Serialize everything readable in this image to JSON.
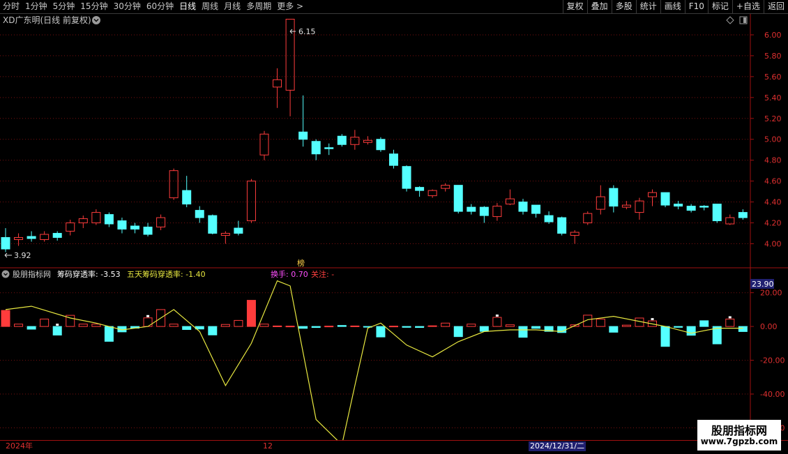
{
  "toolbar": {
    "tabs": [
      "分时",
      "1分钟",
      "5分钟",
      "15分钟",
      "30分钟",
      "60分钟",
      "日线",
      "周线",
      "月线",
      "多周期",
      "更多 >"
    ],
    "active_tab": "日线",
    "tools": [
      "复权",
      "叠加",
      "多股",
      "统计",
      "画线",
      "F10",
      "标记",
      "+自选",
      "返回"
    ]
  },
  "stock": {
    "title": "XD广东明(日线 前复权)"
  },
  "main_chart": {
    "high_label": "6.15",
    "low_label": "3.92",
    "marker_text": "榜",
    "y_ticks": [
      "6.00",
      "5.80",
      "5.60",
      "5.40",
      "5.20",
      "5.00",
      "4.80",
      "4.60",
      "4.40",
      "4.20",
      "4.00"
    ],
    "y_tick_values": [
      6.0,
      5.8,
      5.6,
      5.4,
      5.2,
      5.0,
      4.8,
      4.6,
      4.4,
      4.2,
      4.0
    ],
    "price_range": [
      3.85,
      6.2
    ]
  },
  "indicator": {
    "name": "股朋指标网",
    "series1_label": "筹码穿透率: -3.53",
    "series2_label": "五天筹码穿透率: -1.40",
    "turnover_label": "换手: 0.70",
    "focus_label": "关注: -",
    "current_value": "23.90",
    "y_ticks": [
      "20.00",
      "0.00",
      "-20.00",
      "-40.00",
      "-60.00"
    ],
    "y_tick_values": [
      20,
      0,
      -20,
      -40,
      -60
    ],
    "value_range": [
      -66,
      24
    ]
  },
  "bottom_axis": {
    "labels": [
      "2024年",
      "12"
    ],
    "cursor_date": "2024/12/31/二"
  },
  "watermark": {
    "name": "股朋指标网",
    "url": "www.7gpzb.com"
  },
  "colors": {
    "up": "#ff3c3c",
    "down": "#54ffff",
    "line": "#e8e840",
    "axis": "#a01010",
    "grid": "#7a1010"
  },
  "chart_data": {
    "type": "candlestick",
    "candles": [
      [
        4.06,
        3.95,
        4.15,
        3.92
      ],
      [
        4.04,
        4.06,
        4.1,
        3.98
      ],
      [
        4.07,
        4.05,
        4.12,
        4.02
      ],
      [
        4.04,
        4.09,
        4.12,
        4.02
      ],
      [
        4.1,
        4.06,
        4.12,
        4.03
      ],
      [
        4.12,
        4.2,
        4.23,
        4.08
      ],
      [
        4.2,
        4.24,
        4.27,
        4.15
      ],
      [
        4.2,
        4.3,
        4.33,
        4.18
      ],
      [
        4.28,
        4.19,
        4.3,
        4.16
      ],
      [
        4.22,
        4.14,
        4.25,
        4.1
      ],
      [
        4.17,
        4.14,
        4.2,
        4.1
      ],
      [
        4.16,
        4.09,
        4.2,
        4.07
      ],
      [
        4.16,
        4.25,
        4.28,
        4.13
      ],
      [
        4.44,
        4.7,
        4.72,
        4.42
      ],
      [
        4.51,
        4.38,
        4.65,
        4.35
      ],
      [
        4.32,
        4.25,
        4.36,
        4.2
      ],
      [
        4.27,
        4.1,
        4.28,
        4.09
      ],
      [
        4.08,
        4.1,
        4.12,
        4.0
      ],
      [
        4.15,
        4.1,
        4.22,
        4.08
      ],
      [
        4.22,
        4.6,
        4.62,
        4.2
      ],
      [
        4.85,
        5.05,
        5.08,
        4.8
      ],
      [
        5.5,
        5.57,
        5.68,
        5.3
      ],
      [
        5.47,
        6.15,
        6.15,
        5.22
      ],
      [
        5.07,
        5.0,
        5.42,
        4.93
      ],
      [
        4.98,
        4.86,
        5.0,
        4.8
      ],
      [
        4.92,
        4.91,
        4.96,
        4.85
      ],
      [
        5.03,
        4.95,
        5.05,
        4.93
      ],
      [
        4.95,
        5.02,
        5.09,
        4.9
      ],
      [
        4.97,
        4.99,
        5.03,
        4.95
      ],
      [
        5.0,
        4.9,
        5.02,
        4.88
      ],
      [
        4.86,
        4.75,
        4.9,
        4.72
      ],
      [
        4.74,
        4.53,
        4.75,
        4.5
      ],
      [
        4.54,
        4.51,
        4.55,
        4.45
      ],
      [
        4.46,
        4.51,
        4.52,
        4.44
      ],
      [
        4.53,
        4.56,
        4.58,
        4.5
      ],
      [
        4.56,
        4.31,
        4.56,
        4.29
      ],
      [
        4.35,
        4.31,
        4.38,
        4.28
      ],
      [
        4.35,
        4.27,
        4.36,
        4.2
      ],
      [
        4.26,
        4.36,
        4.39,
        4.22
      ],
      [
        4.38,
        4.43,
        4.52,
        4.37
      ],
      [
        4.4,
        4.31,
        4.43,
        4.28
      ],
      [
        4.37,
        4.29,
        4.37,
        4.25
      ],
      [
        4.27,
        4.21,
        4.31,
        4.19
      ],
      [
        4.25,
        4.1,
        4.26,
        4.08
      ],
      [
        4.08,
        4.11,
        4.13,
        4.0
      ],
      [
        4.2,
        4.29,
        4.31,
        4.18
      ],
      [
        4.33,
        4.45,
        4.56,
        4.28
      ],
      [
        4.53,
        4.36,
        4.56,
        4.3
      ],
      [
        4.35,
        4.37,
        4.41,
        4.33
      ],
      [
        4.3,
        4.41,
        4.44,
        4.23
      ],
      [
        4.45,
        4.49,
        4.52,
        4.36
      ],
      [
        4.49,
        4.37,
        4.49,
        4.35
      ],
      [
        4.38,
        4.36,
        4.41,
        4.33
      ],
      [
        4.36,
        4.32,
        4.38,
        4.3
      ],
      [
        4.36,
        4.35,
        4.37,
        4.32
      ],
      [
        4.38,
        4.22,
        4.38,
        4.2
      ],
      [
        4.19,
        4.25,
        4.28,
        4.18
      ],
      [
        4.3,
        4.25,
        4.33,
        4.23
      ]
    ],
    "bars": [
      {
        "v": 9.5,
        "c": "up",
        "f": true
      },
      {
        "v": 1.4,
        "c": "up"
      },
      {
        "v": -1.6,
        "c": "down"
      },
      {
        "v": 4.4,
        "c": "up"
      },
      {
        "v": -5.1,
        "c": "down"
      },
      {
        "v": 6.6,
        "c": "up"
      },
      {
        "v": 1.4,
        "c": "up"
      },
      {
        "v": 1.4,
        "c": "up"
      },
      {
        "v": -8.8,
        "c": "down"
      },
      {
        "v": -3.2,
        "c": "down"
      },
      {
        "v": -1.0,
        "c": "down"
      },
      {
        "v": 5.1,
        "c": "up"
      },
      {
        "v": 10.0,
        "c": "up"
      },
      {
        "v": 1.4,
        "c": "up"
      },
      {
        "v": -1.8,
        "c": "down"
      },
      {
        "v": -1.5,
        "c": "down"
      },
      {
        "v": -5.0,
        "c": "down"
      },
      {
        "v": 1.2,
        "c": "up"
      },
      {
        "v": 3.6,
        "c": "up"
      },
      {
        "v": 15.5,
        "c": "up",
        "f": true
      },
      {
        "v": 1.4,
        "c": "up"
      },
      {
        "v": 0.3,
        "c": "up"
      },
      {
        "v": 0.2,
        "c": "up"
      },
      {
        "v": -1.1,
        "c": "down"
      },
      {
        "v": -0.6,
        "c": "down"
      },
      {
        "v": 0.2,
        "c": "up"
      },
      {
        "v": 0.6,
        "c": "down"
      },
      {
        "v": 0.3,
        "c": "up"
      },
      {
        "v": -0.4,
        "c": "down"
      },
      {
        "v": -6.2,
        "c": "down"
      },
      {
        "v": 0.2,
        "c": "up"
      },
      {
        "v": -0.5,
        "c": "down"
      },
      {
        "v": -0.6,
        "c": "down"
      },
      {
        "v": 0.4,
        "c": "up"
      },
      {
        "v": 2.0,
        "c": "up"
      },
      {
        "v": -6.0,
        "c": "down"
      },
      {
        "v": 1.4,
        "c": "up"
      },
      {
        "v": -2.9,
        "c": "down"
      },
      {
        "v": 5.4,
        "c": "up"
      },
      {
        "v": 1.0,
        "c": "up"
      },
      {
        "v": -6.4,
        "c": "down"
      },
      {
        "v": -1.1,
        "c": "down"
      },
      {
        "v": -2.9,
        "c": "down"
      },
      {
        "v": -3.6,
        "c": "down"
      },
      {
        "v": 1.0,
        "c": "up"
      },
      {
        "v": 6.7,
        "c": "up"
      },
      {
        "v": 4.4,
        "c": "up"
      },
      {
        "v": -3.4,
        "c": "down"
      },
      {
        "v": 0.8,
        "c": "up"
      },
      {
        "v": 5.0,
        "c": "up"
      },
      {
        "v": 3.3,
        "c": "up"
      },
      {
        "v": -11.8,
        "c": "down"
      },
      {
        "v": -0.5,
        "c": "down"
      },
      {
        "v": -5.2,
        "c": "down"
      },
      {
        "v": 3.4,
        "c": "down"
      },
      {
        "v": -10.3,
        "c": "down"
      },
      {
        "v": 4.4,
        "c": "up"
      },
      {
        "v": -3.0,
        "c": "down"
      }
    ],
    "markers": [
      4,
      11,
      38,
      50,
      56
    ],
    "line_x": [
      0,
      2,
      5,
      7,
      9,
      11,
      13,
      15,
      17,
      19,
      21,
      22,
      24,
      26,
      27,
      28,
      29,
      31,
      33,
      35,
      37,
      39,
      41,
      43,
      45,
      47,
      49,
      51,
      53,
      55,
      57
    ],
    "line_y": [
      10,
      12,
      5,
      2,
      -2,
      0,
      10,
      -3,
      -35,
      -10,
      27,
      24,
      -55,
      -70,
      -35,
      -1,
      2,
      -11,
      -18,
      -9,
      -3,
      -2,
      -2,
      -3,
      4,
      6,
      3,
      0,
      -4,
      -1,
      -1
    ]
  }
}
